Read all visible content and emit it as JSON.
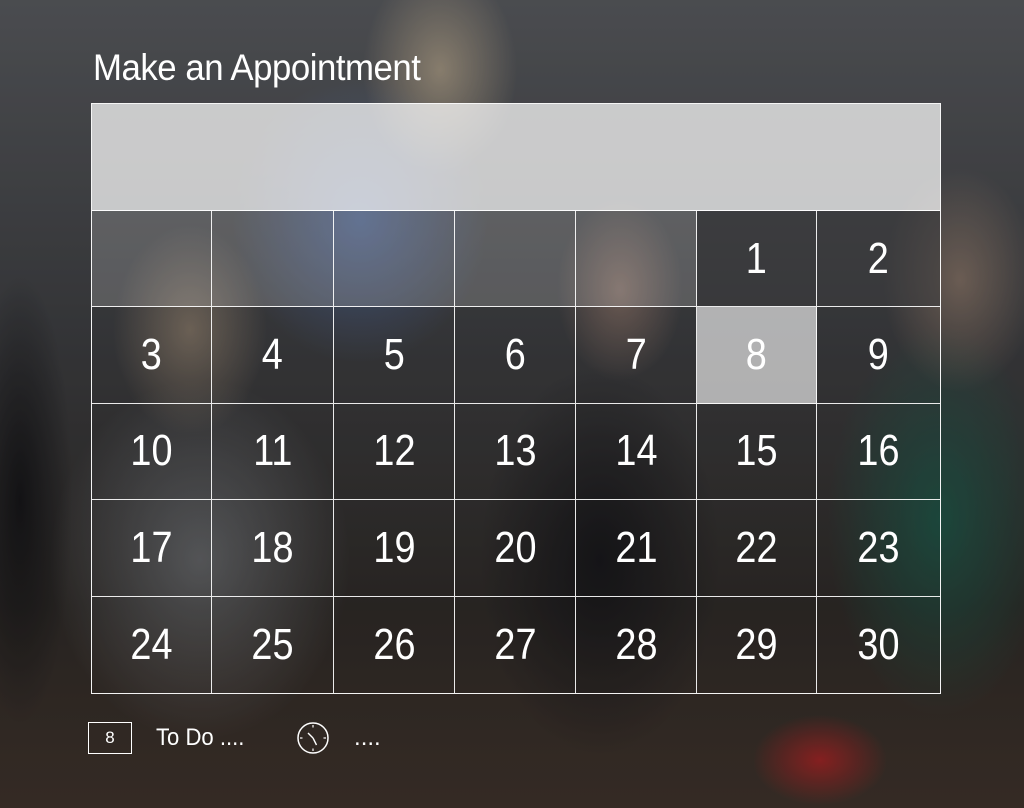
{
  "title": "Make an Appointment",
  "calendar": {
    "rows": [
      [
        "",
        "",
        "",
        "",
        "",
        "1",
        "2"
      ],
      [
        "3",
        "4",
        "5",
        "6",
        "7",
        "8",
        "9"
      ],
      [
        "10",
        "11",
        "12",
        "13",
        "14",
        "15",
        "16"
      ],
      [
        "17",
        "18",
        "19",
        "20",
        "21",
        "22",
        "23"
      ],
      [
        "24",
        "25",
        "26",
        "27",
        "28",
        "29",
        "30"
      ]
    ],
    "selected_day": "8"
  },
  "footer": {
    "day_box": "8",
    "todo_text": "To Do ....",
    "time_icon": "clock-icon",
    "time_text": "...."
  }
}
